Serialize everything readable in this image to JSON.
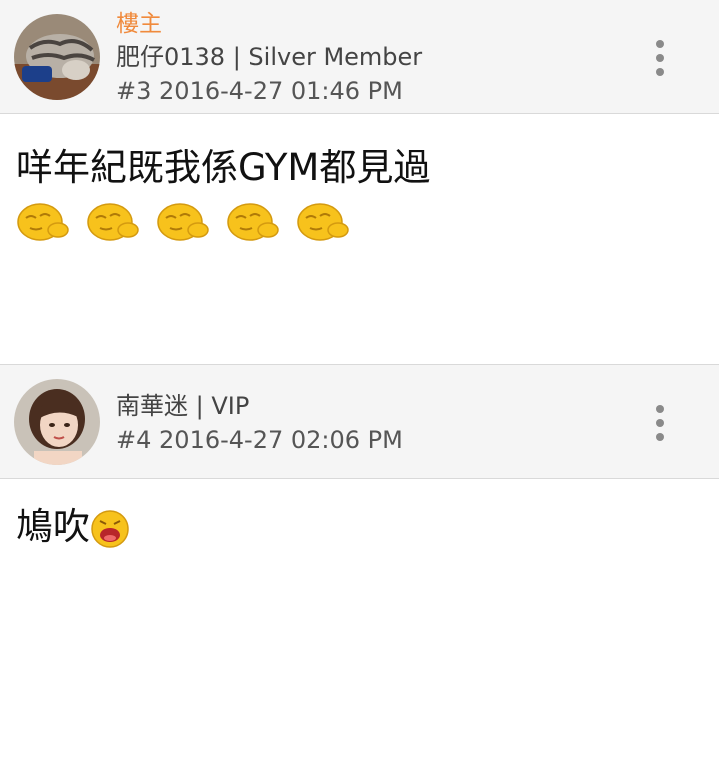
{
  "posts": [
    {
      "op_label": "樓主",
      "author": "肥仔0138",
      "rank": "Silver Member",
      "post_number": "#3",
      "timestamp": "2016-4-27 01:46 PM",
      "content": "咩年紀既我係GYM都見過",
      "emojis": [
        "sleepy-emoji",
        "sleepy-emoji",
        "sleepy-emoji",
        "sleepy-emoji",
        "sleepy-emoji"
      ]
    },
    {
      "author": "南華迷",
      "rank": "VIP",
      "post_number": "#4",
      "timestamp": "2016-4-27 02:06 PM",
      "content": "鳩吹",
      "emojis": [
        "shouting-emoji"
      ]
    }
  ],
  "colors": {
    "op_label": "#f08a3c",
    "header_bg": "#f5f5f5",
    "emoji_yellow": "#f7c21c"
  }
}
